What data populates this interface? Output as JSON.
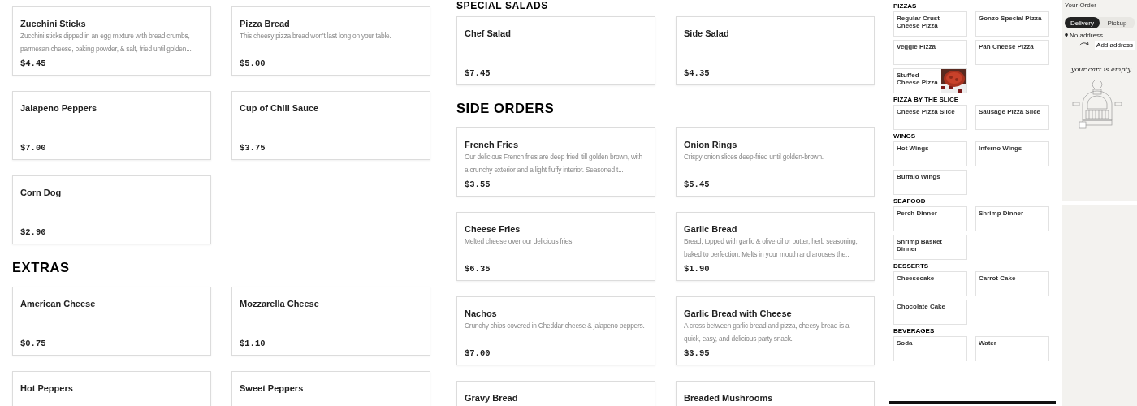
{
  "columns": [
    {
      "sections": [
        {
          "items": [
            {
              "name": "Zucchini Sticks",
              "description": "Zucchini sticks dipped in an egg mixture with bread crumbs, parmesan cheese, baking powder, & salt, fried until golden...",
              "price": "$4.45"
            },
            {
              "name": "Pizza Bread",
              "description": "This cheesy pizza bread won't last long on your table.",
              "price": "$5.00"
            },
            {
              "name": "Jalapeno Peppers",
              "price": "$7.00"
            },
            {
              "name": "Cup of Chili Sauce",
              "price": "$3.75"
            },
            {
              "name": "Corn Dog",
              "price": "$2.90"
            }
          ]
        },
        {
          "title": "EXTRAS",
          "items": [
            {
              "name": "American Cheese",
              "price": "$0.75"
            },
            {
              "name": "Mozzarella Cheese",
              "price": "$1.10"
            },
            {
              "name": "Hot Peppers"
            },
            {
              "name": "Sweet Peppers"
            }
          ]
        }
      ]
    },
    {
      "sections": [
        {
          "title": "SPECIAL SALADS",
          "items": [
            {
              "name": "Chef Salad",
              "price": "$7.45"
            },
            {
              "name": "Side Salad",
              "price": "$4.35"
            }
          ]
        },
        {
          "title": "SIDE ORDERS",
          "items": [
            {
              "name": "French Fries",
              "description": "Our delicious French fries are deep fried 'till golden brown, with a crunchy exterior and a light fluffy interior. Seasoned t...",
              "price": "$3.55"
            },
            {
              "name": "Onion Rings",
              "description": "Crispy onion slices deep-fried until golden-brown.",
              "price": "$5.45"
            },
            {
              "name": "Cheese Fries",
              "description": "Melted cheese over our delicious fries.",
              "price": "$6.35"
            },
            {
              "name": "Garlic Bread",
              "description": "Bread, topped with garlic & olive oil or butter, herb seasoning, baked to perfection. Melts in your mouth and arouses the...",
              "price": "$1.90"
            },
            {
              "name": "Nachos",
              "description": "Crunchy chips covered in Cheddar cheese & jalapeno peppers.",
              "price": "$7.00"
            },
            {
              "name": "Garlic Bread with Cheese",
              "description": "A cross between garlic bread and pizza, cheesy bread is a quick, easy, and delicious party snack.",
              "price": "$3.95"
            },
            {
              "name": "Gravy Bread"
            },
            {
              "name": "Breaded Mushrooms"
            }
          ]
        }
      ]
    }
  ],
  "mini_menu": {
    "sections": [
      {
        "title": "PIZZAS",
        "items": [
          {
            "name": "Regular Crust Cheese Pizza"
          },
          {
            "name": "Gonzo Special Pizza"
          },
          {
            "name": "Veggie Pizza"
          },
          {
            "name": "Pan Cheese Pizza"
          },
          {
            "name": "Stuffed Cheese Pizza",
            "kind": "picture"
          }
        ]
      },
      {
        "title": "PIZZA BY THE SLICE",
        "items": [
          {
            "name": "Cheese Pizza Slice"
          },
          {
            "name": "Sausage Pizza Slice"
          }
        ]
      },
      {
        "title": "WINGS",
        "items": [
          {
            "name": "Hot Wings"
          },
          {
            "name": "Inferno Wings"
          },
          {
            "name": "Buffalo Wings"
          }
        ]
      },
      {
        "title": "SEAFOOD",
        "items": [
          {
            "name": "Perch Dinner"
          },
          {
            "name": "Shrimp Dinner"
          },
          {
            "name": "Shrimp Basket Dinner"
          }
        ]
      },
      {
        "title": "DESSERTS",
        "items": [
          {
            "name": "Cheesecake"
          },
          {
            "name": "Carrot Cake"
          },
          {
            "name": "Chocolate Cake"
          }
        ]
      },
      {
        "title": "BEVERAGES",
        "items": [
          {
            "name": "Soda"
          },
          {
            "name": "Water"
          }
        ]
      }
    ]
  },
  "order_panel": {
    "title": "Your Order",
    "tabs": [
      {
        "label": "Delivery",
        "selected": true
      },
      {
        "label": "Pickup",
        "selected": false
      }
    ],
    "address": "No address",
    "add_button": "Add address",
    "empty_note": "your cart is empty"
  }
}
